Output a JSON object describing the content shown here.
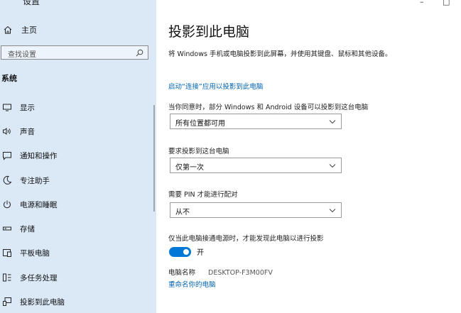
{
  "app": {
    "title": "设置"
  },
  "window_controls": {
    "minimize": "–",
    "close": "□"
  },
  "sidebar": {
    "home_label": "主页",
    "search_placeholder": "查找设置",
    "section_title": "系统",
    "items": [
      {
        "label": "显示",
        "icon": "monitor-icon"
      },
      {
        "label": "声音",
        "icon": "speaker-icon"
      },
      {
        "label": "通知和操作",
        "icon": "notification-icon"
      },
      {
        "label": "专注助手",
        "icon": "moon-icon"
      },
      {
        "label": "电源和睡眠",
        "icon": "power-icon"
      },
      {
        "label": "存储",
        "icon": "storage-icon"
      },
      {
        "label": "平板电脑",
        "icon": "tablet-icon"
      },
      {
        "label": "多任务处理",
        "icon": "multitask-icon"
      },
      {
        "label": "投影到此电脑",
        "icon": "project-icon"
      }
    ]
  },
  "main": {
    "title": "投影到此电脑",
    "description": "将 Windows 手机或电脑投影到此屏幕，并使用其键盘、鼠标和其他设备。",
    "launch_link": "启动“连接”应用以投影到此电脑",
    "setting1": {
      "label": "当你同意时，部分 Windows 和 Android 设备可以投影到这台电脑",
      "value": "所有位置都可用"
    },
    "setting2": {
      "label": "要求投影到这台电脑",
      "value": "仅第一次"
    },
    "setting3": {
      "label": "需要 PIN 才能进行配对",
      "value": "从不"
    },
    "power_label": "仅当此电脑接通电源时，才能发现此电脑以进行投影",
    "toggle_state": "开",
    "pc_name_label": "电脑名称",
    "pc_name_value": "DESKTOP-F3M00FV",
    "rename_link": "重命名你的电脑"
  },
  "colors": {
    "sidebar_bg": "#dbe9f7",
    "accent": "#0078d7",
    "link": "#0063b1"
  }
}
